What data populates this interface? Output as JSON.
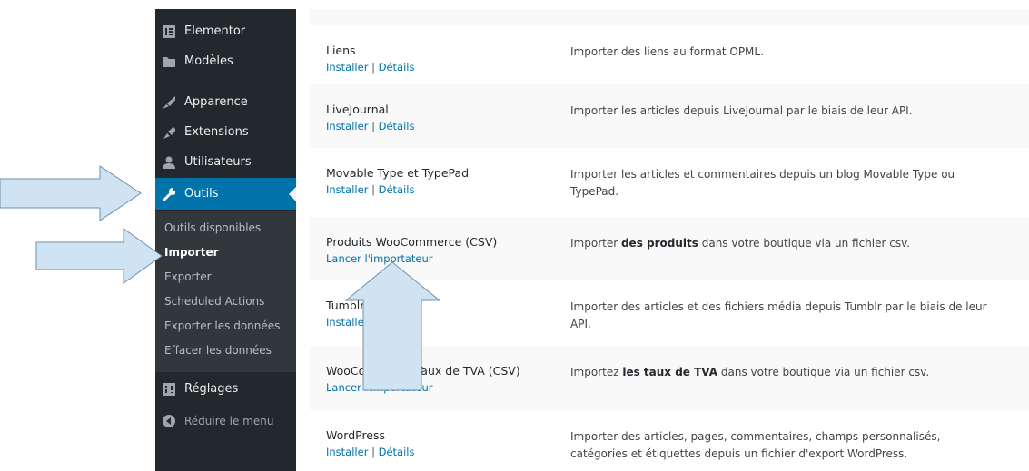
{
  "sidebar": {
    "items": [
      {
        "label": "Elementor",
        "icon": "elementor-icon"
      },
      {
        "label": "Modèles",
        "icon": "folder-icon"
      },
      {
        "label": "Apparence",
        "icon": "paintbrush-icon"
      },
      {
        "label": "Extensions",
        "icon": "plugin-icon"
      },
      {
        "label": "Utilisateurs",
        "icon": "user-icon"
      },
      {
        "label": "Outils",
        "icon": "wrench-icon"
      }
    ],
    "submenu": [
      {
        "label": "Outils disponibles"
      },
      {
        "label": "Importer"
      },
      {
        "label": "Exporter"
      },
      {
        "label": "Scheduled Actions"
      },
      {
        "label": "Exporter les données"
      },
      {
        "label": "Effacer les données"
      }
    ],
    "after": [
      {
        "label": "Réglages",
        "icon": "settings-icon"
      },
      {
        "label": "Réduire le menu",
        "icon": "collapse-icon"
      }
    ],
    "colors": {
      "bg": "#23282d",
      "active": "#0073aa",
      "submenu_bg": "#32373c"
    }
  },
  "importers": [
    {
      "name": "Liens",
      "install": "Installer",
      "sep": " | ",
      "details": "Détails",
      "desc": "Importer des liens au format OPML."
    },
    {
      "name": "LiveJournal",
      "install": "Installer",
      "sep": " | ",
      "details": "Détails",
      "desc": "Importer les articles depuis LiveJournal par le biais de leur API."
    },
    {
      "name": "Movable Type et TypePad",
      "install": "Installer",
      "sep": " | ",
      "details": "Détails",
      "desc": "Importer les articles et commentaires depuis un blog Movable Type ou TypePad."
    },
    {
      "name": "Produits WooCommerce (CSV)",
      "action": "Lancer l'importateur",
      "desc_pre": "Importer ",
      "desc_bold": "des produits",
      "desc_post": " dans votre boutique via un fichier csv."
    },
    {
      "name": "Tumblr",
      "install": "Installer",
      "sep": " | ",
      "details": "Détails",
      "desc": "Importer des articles et des fichiers média depuis Tumblr par le biais de leur API."
    },
    {
      "name": "WooCommerce Taux de TVA (CSV)",
      "action": "Lancer l'importateur",
      "desc_pre": "Importez ",
      "desc_bold": "les taux de TVA",
      "desc_post": " dans votre boutique via un fichier csv."
    },
    {
      "name": "WordPress",
      "install": "Installer",
      "sep": " | ",
      "details": "Détails",
      "desc": "Importer des articles, pages, commentaires, champs personnalisés, catégories et étiquettes depuis un fichier d'export WordPress."
    }
  ],
  "link_color": "#0073aa",
  "arrow_color": "#cfe3f3"
}
